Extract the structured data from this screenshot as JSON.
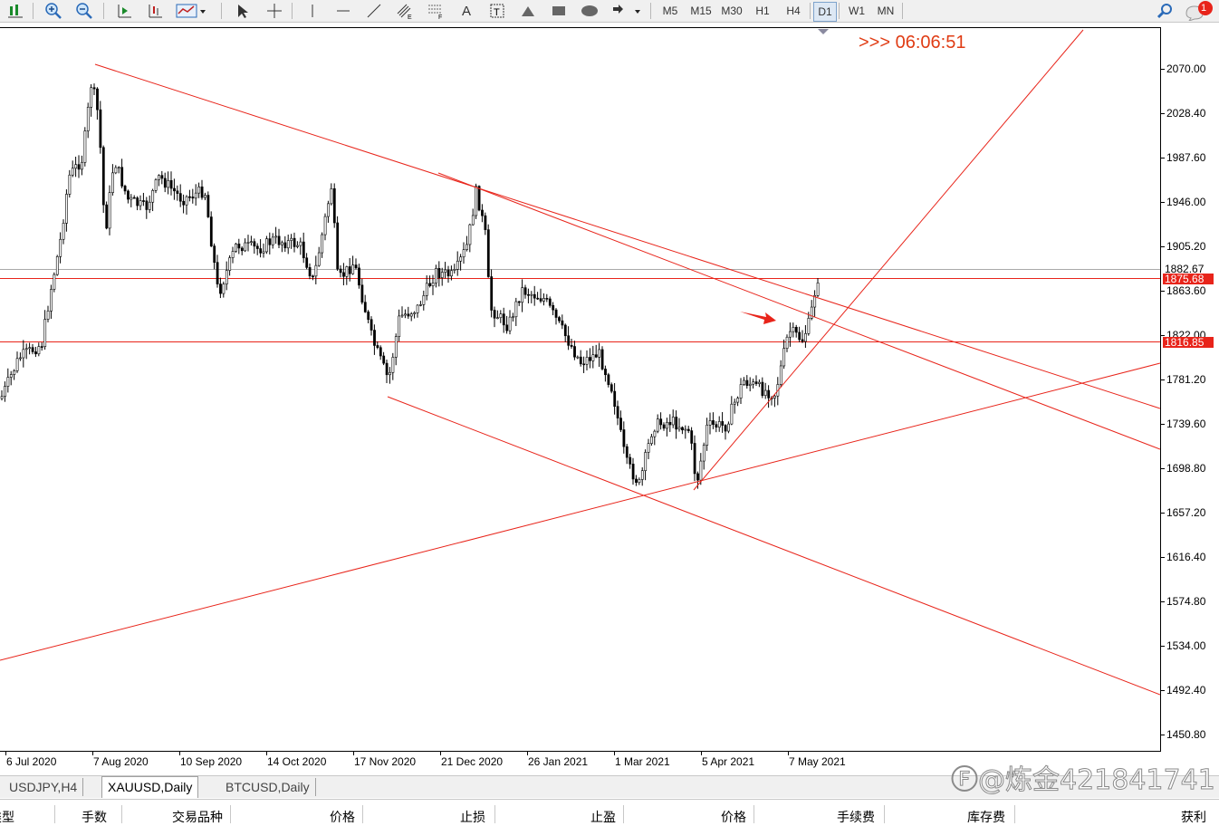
{
  "toolbar": {
    "timeframes": [
      "M5",
      "M15",
      "M30",
      "H1",
      "H4",
      "D1",
      "W1",
      "MN"
    ],
    "active_timeframe": "D1",
    "notification_count": "1"
  },
  "timer": ">>> 06:06:51",
  "yaxis": {
    "labels": [
      "2070.00",
      "2028.40",
      "1987.60",
      "1946.00",
      "1905.20",
      "1863.60",
      "1822.00",
      "1781.20",
      "1739.60",
      "1698.80",
      "1657.20",
      "1616.40",
      "1574.80",
      "1534.00",
      "1492.40",
      "1450.80"
    ],
    "price_tags": [
      {
        "label": "1882.67",
        "price": 1882.67,
        "style": "plain"
      },
      {
        "label": "1875.68",
        "price": 1875.68,
        "style": "red"
      },
      {
        "label": "1816.85",
        "price": 1816.85,
        "style": "red"
      }
    ]
  },
  "xaxis": {
    "labels": [
      "6 Jul 2020",
      "7 Aug 2020",
      "10 Sep 2020",
      "14 Oct 2020",
      "17 Nov 2020",
      "21 Dec 2020",
      "26 Jan 2021",
      "1 Mar 2021",
      "5 Apr 2021",
      "7 May 2021"
    ]
  },
  "tabs": [
    {
      "label": "USDJPY,H4",
      "active": false
    },
    {
      "label": "XAUUSD,Daily",
      "active": true
    },
    {
      "label": "BTCUSD,Daily",
      "active": false
    }
  ],
  "watermark": "Ⓕ@炼金421841741",
  "terminal": {
    "headers": [
      "类型",
      "手数",
      "交易品种",
      "价格",
      "止损",
      "止盈",
      "价格",
      "手续费",
      "库存费",
      "获利"
    ]
  },
  "colors": {
    "line": "#e8241a",
    "candle": "#000000",
    "timer": "#e03c14"
  }
}
